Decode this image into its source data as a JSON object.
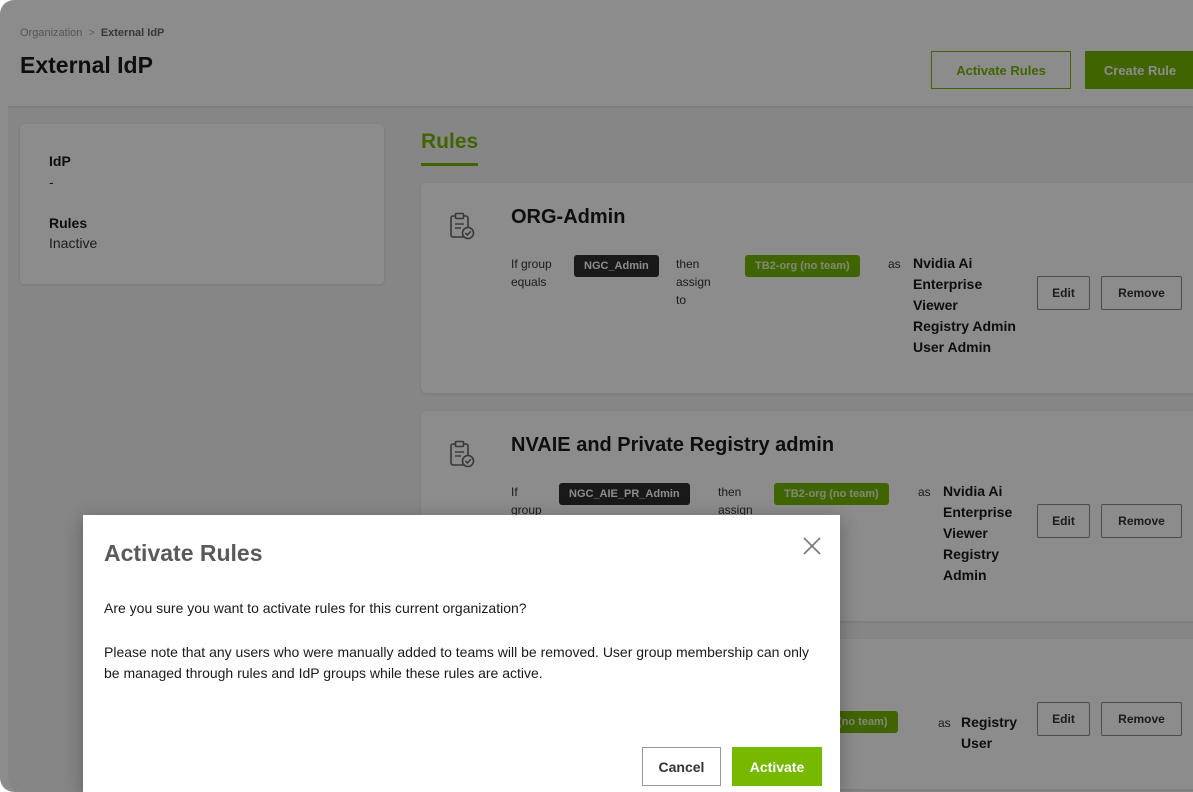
{
  "breadcrumb": {
    "root": "Organization",
    "separator": ">",
    "current": "External IdP"
  },
  "page": {
    "title": "External IdP"
  },
  "header_actions": {
    "activate_rules": "Activate Rules",
    "create_rule": "Create Rule"
  },
  "info_panel": {
    "idp_label": "IdP",
    "idp_value": "-",
    "rules_label": "Rules",
    "rules_value": "Inactive"
  },
  "tabs": {
    "rules": "Rules"
  },
  "rules": [
    {
      "title": "ORG-Admin",
      "if_text": [
        "If group",
        "equals"
      ],
      "group": "NGC_Admin",
      "then_text": [
        "then",
        "assign",
        "to"
      ],
      "target": "TB2-org (no team)",
      "as_text": "as",
      "roles": [
        "Nvidia Ai",
        "Enterprise",
        "Viewer",
        "Registry Admin",
        "User Admin"
      ],
      "edit": "Edit",
      "remove": "Remove"
    },
    {
      "title": "NVAIE and Private Registry admin",
      "if_text": [
        "If",
        "group"
      ],
      "group": "NGC_AIE_PR_Admin",
      "then_text": [
        "then",
        "assign"
      ],
      "target": "TB2-org (no team)",
      "as_text": "as",
      "roles": [
        "Nvidia Ai",
        "Enterprise",
        "Viewer",
        "Registry",
        "Admin"
      ],
      "edit": "Edit",
      "remove": "Remove"
    },
    {
      "target": "(no team)",
      "as_text": "as",
      "roles": [
        "Registry",
        "User"
      ],
      "edit": "Edit",
      "remove": "Remove"
    }
  ],
  "modal": {
    "title": "Activate Rules",
    "question": "Are you sure you want to activate rules for this current organization?",
    "note": "Please note that any users who were manually added to teams will be removed. User group membership can only be managed through rules and IdP groups while these rules are active.",
    "cancel": "Cancel",
    "activate": "Activate"
  },
  "colors": {
    "accent": "#76b900",
    "dark_pill": "#2f2f2f"
  }
}
